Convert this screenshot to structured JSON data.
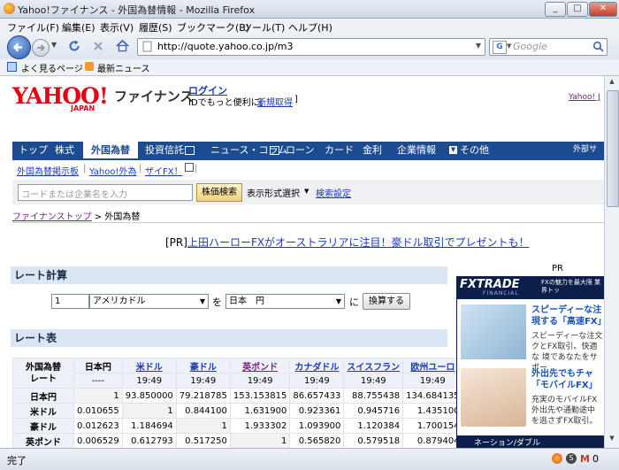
{
  "window": {
    "title": "Yahoo!ファイナンス - 外国為替情報 - Mozilla Firefox"
  },
  "menu": [
    "ファイル(F)",
    "編集(E)",
    "表示(V)",
    "履歴(S)",
    "ブックマーク(B)",
    "ツール(T)",
    "ヘルプ(H)"
  ],
  "nav": {
    "url": "http://quote.yahoo.co.jp/m3",
    "search_placeholder": "Google"
  },
  "bookmarks": [
    "よく見るページ",
    "最新ニュース"
  ],
  "header": {
    "logo_main": "YAHOO!",
    "logo_sub": "JAPAN",
    "logo_product": "ファイナンス",
    "login": "ログイン",
    "id_text": "IDでもっと便利に[",
    "signup": "新規取得",
    "id_close": "]",
    "right_link": "Yahoo! J"
  },
  "tabs": [
    "トップ",
    "株式",
    "外国為替",
    "投資信託",
    "ニュース・コラム",
    "ローン",
    "カード",
    "金利",
    "企業情報",
    "その他",
    "外部サ"
  ],
  "subnav": [
    "外国為替掲示板",
    "Yahoo!外為",
    "ザイFX！"
  ],
  "search": {
    "placeholder": "コードまたは企業名を入力",
    "button": "株価検索",
    "format": "表示形式選択",
    "link": "検索設定"
  },
  "breadcrumb": {
    "home": "ファイナンストップ",
    "sep": ">",
    "current": "外国為替"
  },
  "pr": {
    "prefix": "[PR]",
    "text": "上田ハーローFXがオーストラリアに注目！豪ドル取引でプレゼントも！"
  },
  "calc": {
    "heading": "レート計算",
    "amount": "1",
    "from": "アメリカドル",
    "wo": "を",
    "to": "日本　円",
    "ni": "に",
    "button": "換算する"
  },
  "rates": {
    "heading": "レート表",
    "corner": [
      "外国為替",
      "レート"
    ],
    "columns": [
      {
        "name": "日本円",
        "time": "----",
        "link": false
      },
      {
        "name": "米ドル",
        "time": "19:49",
        "link": true
      },
      {
        "name": "豪ドル",
        "time": "19:49",
        "link": true
      },
      {
        "name": "英ポンド",
        "time": "19:49",
        "link": true
      },
      {
        "name": "カナダドル",
        "time": "19:49",
        "link": true
      },
      {
        "name": "スイスフラン",
        "time": "19:49",
        "link": true
      },
      {
        "name": "欧州ユーロ",
        "time": "19:49",
        "link": true
      }
    ],
    "rows": [
      {
        "label": "日本円",
        "values": [
          "1",
          "93.850000",
          "79.218785",
          "153.153815",
          "86.657433",
          "88.755438",
          "134.684135"
        ]
      },
      {
        "label": "米ドル",
        "values": [
          "0.010655",
          "1",
          "0.844100",
          "1.631900",
          "0.923361",
          "0.945716",
          "1.435100"
        ]
      },
      {
        "label": "豪ドル",
        "values": [
          "0.012623",
          "1.184694",
          "1",
          "1.933302",
          "1.093900",
          "1.120384",
          "1.700154"
        ]
      },
      {
        "label": "英ポンド",
        "values": [
          "0.006529",
          "0.612793",
          "0.517250",
          "1",
          "0.565820",
          "0.579518",
          "0.879404"
        ]
      }
    ]
  },
  "ad": {
    "label": "PR",
    "brand": "FXTRADE",
    "brand_sub": "FINANCIAL",
    "tagline": "FXの魅力を最大限 業界トッ",
    "h1": "スピーディーな注 現する「高速FX」",
    "p1": "スピーディーな注文 クとFX取引。快適な 境であなたをサポー",
    "h2": "外出先でもチャ 「モバイルFX」",
    "p2": "充実のモバイルFX 外出先や通勤途中 を逃さずFX取引。",
    "bottom": "ネーション/ダブル"
  },
  "status": {
    "text": "完了",
    "mail_count": "0"
  },
  "colors": {
    "nav_blue": "#1d4b8f",
    "link": "#1a3bb5",
    "yahoo_red": "#e60012",
    "section_bg": "#dbe6f5"
  }
}
